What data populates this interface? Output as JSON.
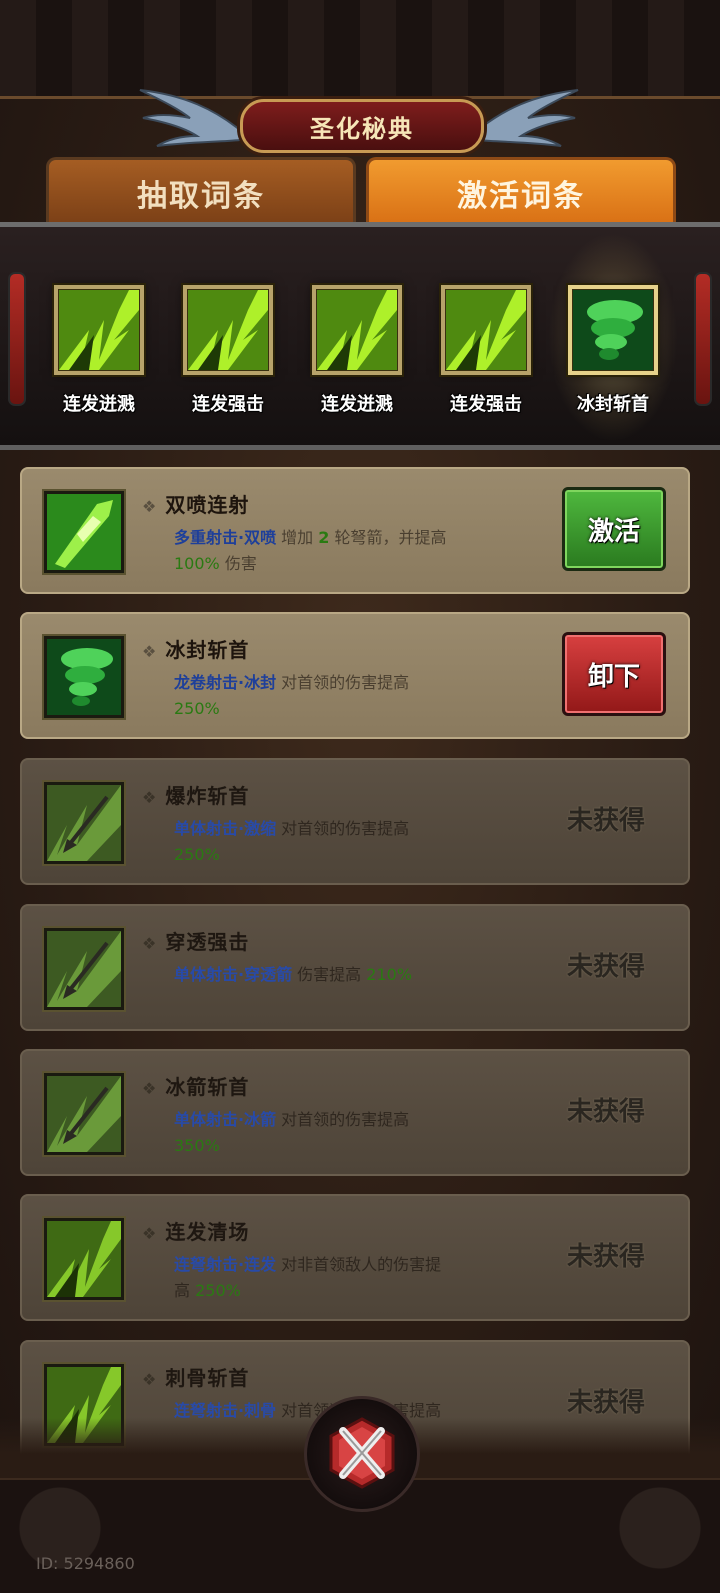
{
  "window": {
    "title": "圣化秘典",
    "player_id": "ID: 5294860"
  },
  "tabs": [
    {
      "label": "抽取词条",
      "active": false
    },
    {
      "label": "激活词条",
      "active": true
    }
  ],
  "equipped_slots": [
    {
      "label": "连发迸溅",
      "icon": "arrow-burst-icon"
    },
    {
      "label": "连发强击",
      "icon": "arrow-burst-icon"
    },
    {
      "label": "连发迸溅",
      "icon": "arrow-burst-icon"
    },
    {
      "label": "连发强击",
      "icon": "arrow-burst-icon"
    },
    {
      "label": "冰封斩首",
      "icon": "ice-tornado-icon",
      "highlighted": true
    }
  ],
  "entries": [
    {
      "title": "双喷连射",
      "skill": "多重射击·双喷",
      "desc_pre": " 增加 ",
      "desc_num": "2",
      "desc_post": " 轮弩箭，并提高",
      "pct": "100%",
      "pct_suffix": " 伤害",
      "status": "owned",
      "action": "激活",
      "icon": "crystal-arrow-icon"
    },
    {
      "title": "冰封斩首",
      "skill": "龙卷射击·冰封",
      "desc": " 对首领的伤害提高",
      "pct": "250%",
      "status": "equipped",
      "action": "卸下",
      "icon": "ice-tornado-icon"
    },
    {
      "title": "爆炸斩首",
      "skill": "单体射击·激缩",
      "desc": " 对首领的伤害提高",
      "pct": "250%",
      "status": "locked",
      "action": "未获得",
      "icon": "spear-icon"
    },
    {
      "title": "穿透强击",
      "skill": "单体射击·穿透箭",
      "desc": " 伤害提高 ",
      "pct": "210%",
      "status": "locked",
      "action": "未获得",
      "icon": "spear-icon"
    },
    {
      "title": "冰箭斩首",
      "skill": "单体射击·冰箭",
      "desc": " 对首领的伤害提高",
      "pct": "350%",
      "status": "locked",
      "action": "未获得",
      "icon": "spear-icon"
    },
    {
      "title": "连发清场",
      "skill": "连弩射击·连发",
      "desc": " 对非首领敌人的伤害提",
      "desc2": "高 ",
      "pct": "250%",
      "status": "locked",
      "action": "未获得",
      "icon": "arrow-burst-icon"
    },
    {
      "title": "刺骨斩首",
      "skill": "连弩射击·刺骨",
      "desc": " 对首领造成的伤害提高",
      "status": "locked",
      "action": "未获得",
      "icon": "arrow-burst-icon"
    }
  ],
  "colors": {
    "tab_active": "#e8841f",
    "tab_inactive": "#8e4c1b",
    "activate_button": "#3a9a2e",
    "unequip_button": "#b82a2a",
    "skill_text": "#1e3f9a",
    "percent_text": "#2a7a12"
  },
  "close_button": {
    "icon": "close-x-icon"
  }
}
